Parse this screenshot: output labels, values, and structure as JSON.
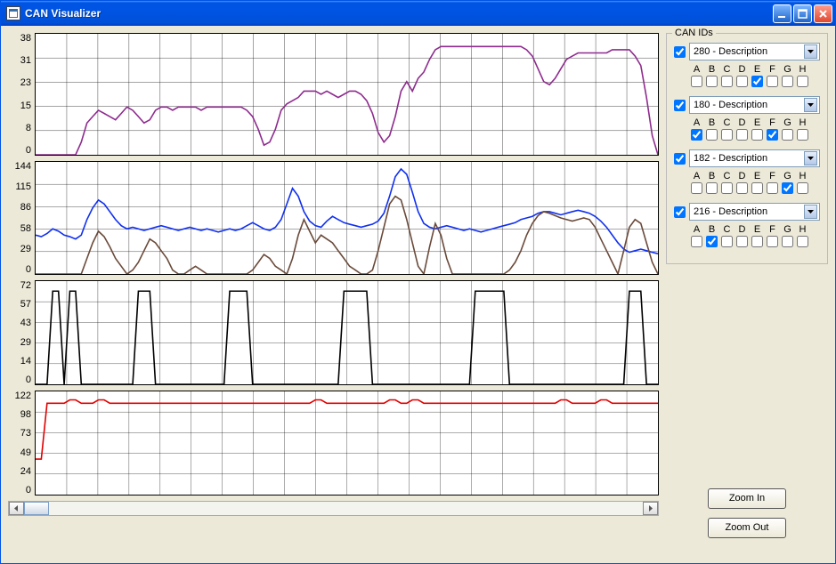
{
  "window": {
    "title": "CAN Visualizer"
  },
  "sidebar": {
    "group_title": "CAN IDs",
    "byte_headers": [
      "A",
      "B",
      "C",
      "D",
      "E",
      "F",
      "G",
      "H"
    ],
    "items": [
      {
        "enabled": true,
        "label": "280 - Description",
        "bytes": [
          false,
          false,
          false,
          false,
          true,
          false,
          false,
          false
        ]
      },
      {
        "enabled": true,
        "label": "180 - Description",
        "bytes": [
          true,
          false,
          false,
          false,
          false,
          true,
          false,
          false
        ]
      },
      {
        "enabled": true,
        "label": "182 - Description",
        "bytes": [
          false,
          false,
          false,
          false,
          false,
          false,
          true,
          false
        ]
      },
      {
        "enabled": true,
        "label": "216 - Description",
        "bytes": [
          false,
          true,
          false,
          false,
          false,
          false,
          false,
          false
        ]
      }
    ]
  },
  "buttons": {
    "zoom_in": "Zoom In",
    "zoom_out": "Zoom Out"
  },
  "chart_data": [
    {
      "type": "line",
      "ylim": [
        0,
        38
      ],
      "yticks": [
        0,
        8,
        15,
        23,
        31,
        38
      ],
      "grid": {
        "cols": 20,
        "rows": 5
      },
      "series": [
        {
          "name": "280-E",
          "color": "#8e2b8e",
          "values": [
            0,
            0,
            0,
            0,
            0,
            0,
            0,
            0,
            4,
            10,
            12,
            14,
            13,
            12,
            11,
            13,
            15,
            14,
            12,
            10,
            11,
            14,
            15,
            15,
            14,
            15,
            15,
            15,
            15,
            14,
            15,
            15,
            15,
            15,
            15,
            15,
            15,
            14,
            12,
            8,
            3,
            4,
            8,
            14,
            16,
            17,
            18,
            20,
            20,
            20,
            19,
            20,
            19,
            18,
            19,
            20,
            20,
            19,
            17,
            13,
            7,
            4,
            6,
            12,
            20,
            23,
            20,
            24,
            26,
            30,
            33,
            34,
            34,
            34,
            34,
            34,
            34,
            34,
            34,
            34,
            34,
            34,
            34,
            34,
            34,
            34,
            33,
            31,
            27,
            23,
            22,
            24,
            27,
            30,
            31,
            32,
            32,
            32,
            32,
            32,
            32,
            33,
            33,
            33,
            33,
            31,
            28,
            18,
            6,
            0
          ]
        }
      ]
    },
    {
      "type": "line",
      "ylim": [
        0,
        144
      ],
      "yticks": [
        0,
        29,
        58,
        86,
        115,
        144
      ],
      "grid": {
        "cols": 20,
        "rows": 5
      },
      "series": [
        {
          "name": "180-A",
          "color": "#1030f0",
          "values": [
            50,
            48,
            52,
            58,
            55,
            50,
            48,
            45,
            50,
            70,
            85,
            95,
            90,
            80,
            70,
            62,
            58,
            60,
            58,
            56,
            58,
            60,
            62,
            60,
            58,
            56,
            58,
            60,
            58,
            56,
            58,
            56,
            54,
            56,
            58,
            56,
            58,
            62,
            66,
            62,
            58,
            56,
            60,
            70,
            90,
            110,
            100,
            80,
            68,
            62,
            60,
            68,
            74,
            70,
            66,
            64,
            62,
            60,
            62,
            64,
            68,
            78,
            100,
            125,
            135,
            128,
            105,
            80,
            65,
            60,
            58,
            60,
            62,
            60,
            58,
            56,
            58,
            56,
            54,
            56,
            58,
            60,
            62,
            64,
            66,
            70,
            72,
            74,
            78,
            80,
            80,
            78,
            76,
            78,
            80,
            82,
            80,
            78,
            74,
            68,
            60,
            50,
            40,
            32,
            28,
            30,
            32,
            30,
            28,
            26
          ]
        },
        {
          "name": "180-F",
          "color": "#6a4a3a",
          "values": [
            0,
            0,
            0,
            0,
            0,
            0,
            0,
            0,
            0,
            20,
            40,
            55,
            48,
            35,
            20,
            10,
            0,
            5,
            15,
            30,
            45,
            40,
            30,
            20,
            5,
            0,
            0,
            5,
            10,
            5,
            0,
            0,
            0,
            0,
            0,
            0,
            0,
            0,
            5,
            15,
            25,
            20,
            10,
            5,
            0,
            20,
            50,
            70,
            55,
            40,
            50,
            45,
            40,
            30,
            20,
            10,
            5,
            0,
            0,
            5,
            30,
            60,
            90,
            100,
            95,
            70,
            40,
            10,
            0,
            35,
            65,
            50,
            20,
            0,
            0,
            0,
            0,
            0,
            0,
            0,
            0,
            0,
            0,
            5,
            15,
            30,
            50,
            65,
            75,
            80,
            78,
            75,
            72,
            70,
            68,
            70,
            72,
            70,
            60,
            45,
            30,
            15,
            0,
            30,
            60,
            70,
            65,
            40,
            15,
            0
          ]
        }
      ]
    },
    {
      "type": "line",
      "ylim": [
        0,
        72
      ],
      "yticks": [
        0,
        14,
        29,
        43,
        57,
        72
      ],
      "grid": {
        "cols": 20,
        "rows": 5
      },
      "series": [
        {
          "name": "182-G",
          "color": "#000",
          "values": [
            0,
            0,
            0,
            65,
            65,
            0,
            65,
            65,
            0,
            0,
            0,
            0,
            0,
            0,
            0,
            0,
            0,
            0,
            65,
            65,
            65,
            0,
            0,
            0,
            0,
            0,
            0,
            0,
            0,
            0,
            0,
            0,
            0,
            0,
            65,
            65,
            65,
            65,
            0,
            0,
            0,
            0,
            0,
            0,
            0,
            0,
            0,
            0,
            0,
            0,
            0,
            0,
            0,
            0,
            65,
            65,
            65,
            65,
            65,
            0,
            0,
            0,
            0,
            0,
            0,
            0,
            0,
            0,
            0,
            0,
            0,
            0,
            0,
            0,
            0,
            0,
            0,
            65,
            65,
            65,
            65,
            65,
            65,
            0,
            0,
            0,
            0,
            0,
            0,
            0,
            0,
            0,
            0,
            0,
            0,
            0,
            0,
            0,
            0,
            0,
            0,
            0,
            0,
            0,
            65,
            65,
            65,
            0,
            0,
            0
          ]
        }
      ]
    },
    {
      "type": "line",
      "ylim": [
        0,
        122
      ],
      "yticks": [
        0,
        24,
        49,
        73,
        98,
        122
      ],
      "grid": {
        "cols": 20,
        "rows": 5
      },
      "series": [
        {
          "name": "216-B",
          "color": "#e00000",
          "values": [
            42,
            42,
            108,
            108,
            108,
            108,
            112,
            112,
            108,
            108,
            108,
            112,
            112,
            108,
            108,
            108,
            108,
            108,
            108,
            108,
            108,
            108,
            108,
            108,
            108,
            108,
            108,
            108,
            108,
            108,
            108,
            108,
            108,
            108,
            108,
            108,
            108,
            108,
            108,
            108,
            108,
            108,
            108,
            108,
            108,
            108,
            108,
            108,
            108,
            112,
            112,
            108,
            108,
            108,
            108,
            108,
            108,
            108,
            108,
            108,
            108,
            108,
            112,
            112,
            108,
            108,
            112,
            112,
            108,
            108,
            108,
            108,
            108,
            108,
            108,
            108,
            108,
            108,
            108,
            108,
            108,
            108,
            108,
            108,
            108,
            108,
            108,
            108,
            108,
            108,
            108,
            108,
            112,
            112,
            108,
            108,
            108,
            108,
            108,
            112,
            112,
            108,
            108,
            108,
            108,
            108,
            108,
            108,
            108,
            108
          ]
        }
      ]
    }
  ]
}
